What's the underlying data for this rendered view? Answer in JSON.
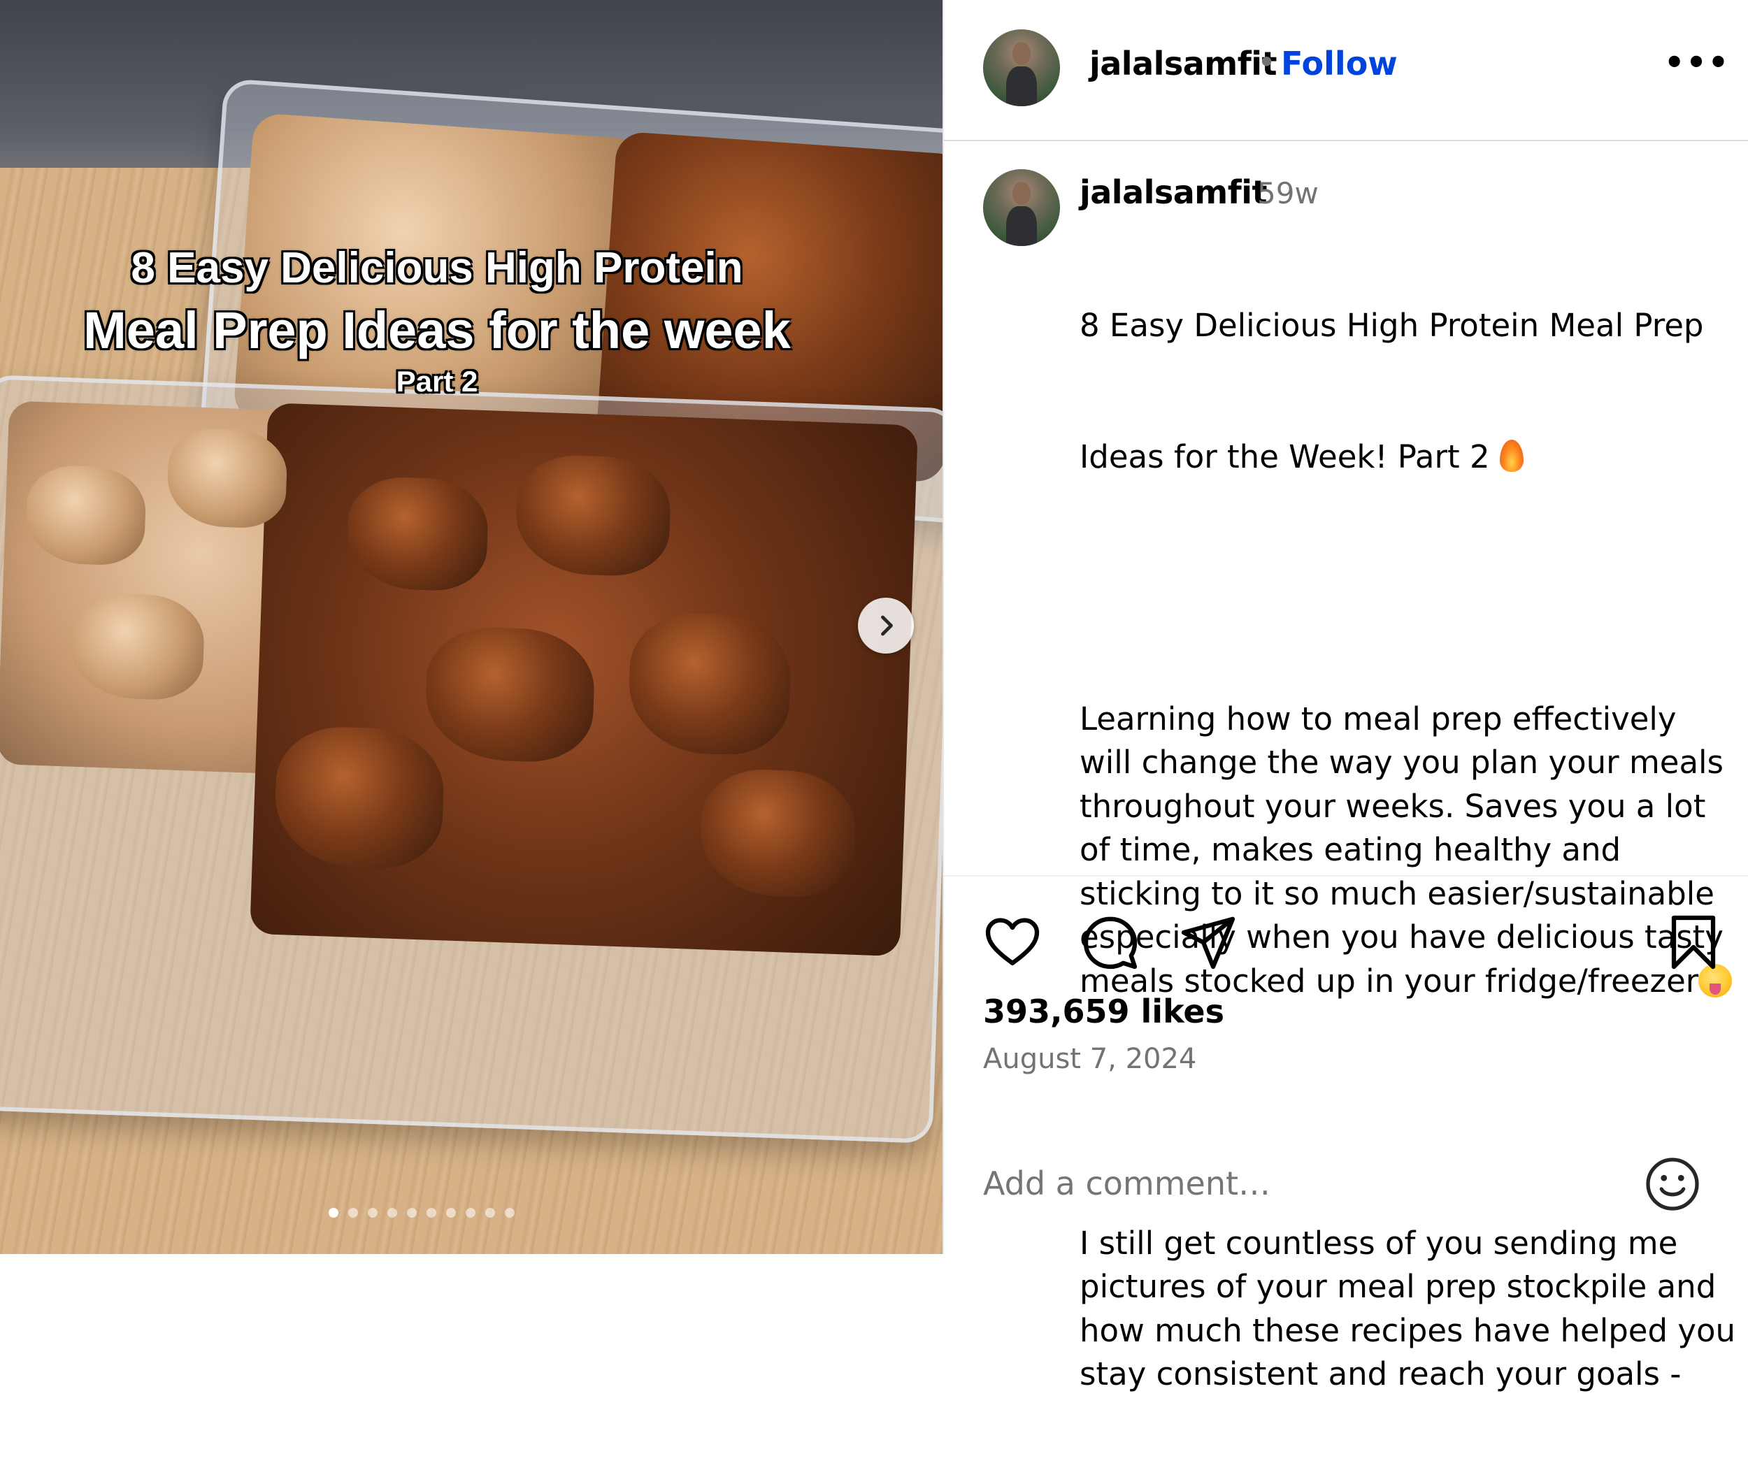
{
  "media": {
    "overlay_title_line1": "8 Easy Delicious High Protein",
    "overlay_title_line2": "Meal Prep Ideas for the week",
    "overlay_title_line3": "Part 2",
    "carousel_total": 10,
    "carousel_index": 1,
    "next_icon": "chevron-right-icon"
  },
  "header": {
    "username": "jalalsamfit",
    "separator": "•",
    "follow_label": "Follow",
    "more_label": "•••"
  },
  "caption": {
    "username": "jalalsamfit",
    "time": "59w",
    "line1": "8 Easy Delicious High Protein Meal Prep",
    "line2": "Ideas for the Week! Part 2 ",
    "para2": "Learning how to meal prep effectively will change the way you plan your meals throughout your weeks. Saves you a lot of time, makes eating healthy and sticking to it so much easier/sustainable especially when you have delicious tasty meals stocked up in your fridge/freezer",
    "para3": "I still get countless of you sending me pictures of your meal prep stockpile and how much these recipes have helped you stay consistent and reach your goals -"
  },
  "actions": {
    "like_icon": "heart-icon",
    "comment_icon": "comment-icon",
    "share_icon": "paper-plane-icon",
    "save_icon": "bookmark-icon"
  },
  "likes": "393,659 likes",
  "date": "August 7, 2024",
  "comment": {
    "placeholder": "Add a comment…",
    "emoji_icon": "smiley-icon"
  },
  "colors": {
    "follow": "#0044dd",
    "muted": "#737373",
    "divider": "#dbdbdb"
  }
}
